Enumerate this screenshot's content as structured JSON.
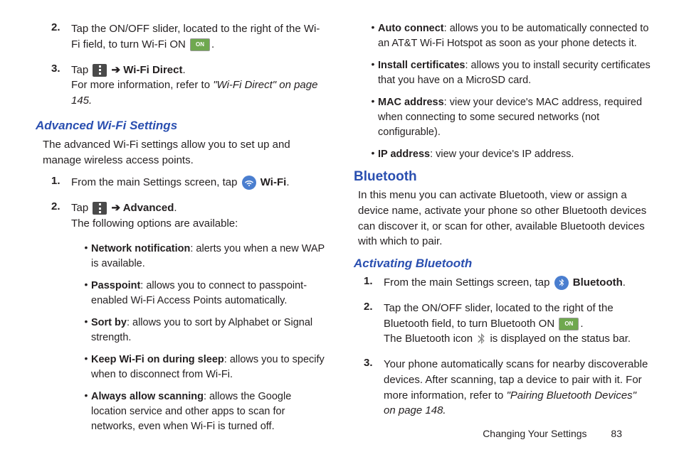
{
  "left": {
    "step2": {
      "num": "2.",
      "text_a": "Tap the ON/OFF slider, located to the right of the Wi-Fi field, to turn Wi-Fi ON ",
      "text_b": "."
    },
    "step3": {
      "num": "3.",
      "tap": "Tap ",
      "arrow": " ➔ ",
      "wifi_direct": "Wi-Fi Direct",
      "period": ".",
      "more_a": "For more information, refer to ",
      "more_b": "\"Wi-Fi Direct\"  on page 145."
    },
    "adv_hdr": "Advanced Wi-Fi Settings",
    "adv_intro": "The advanced Wi-Fi settings allow you to set up and manage wireless access points.",
    "adv_step1": {
      "num": "1.",
      "text_a": "From the main Settings screen, tap ",
      "wifi": " Wi-Fi",
      "period": "."
    },
    "adv_step2": {
      "num": "2.",
      "tap": "Tap ",
      "arrow": " ➔ ",
      "advanced": "Advanced",
      "period": ".",
      "follow": "The following options are available:"
    },
    "bullets": [
      {
        "term": "Network notification",
        "rest": ": alerts you when a new WAP is available."
      },
      {
        "term": "Passpoint",
        "rest": ": allows you to connect to passpoint-enabled Wi-Fi Access Points automatically."
      },
      {
        "term": "Sort by",
        "rest": ": allows you to sort by Alphabet or Signal strength."
      },
      {
        "term": "Keep Wi-Fi on during sleep",
        "rest": ": allows you to specify when to disconnect from Wi-Fi."
      },
      {
        "term": "Always allow scanning",
        "rest": ": allows the Google location service and other apps to scan for networks, even when Wi-Fi is turned off."
      }
    ]
  },
  "right": {
    "bullets_top": [
      {
        "term": "Auto connect",
        "rest": ": allows you to be automatically connected to an AT&T Wi-Fi Hotspot as soon as your phone detects it."
      },
      {
        "term": "Install certificates",
        "rest": ": allows you to install security certificates that you have on a MicroSD card."
      },
      {
        "term": "MAC address",
        "rest": ": view your device's MAC address, required when connecting to some secured networks (not configurable)."
      },
      {
        "term": "IP address",
        "rest": ": view your device's IP address."
      }
    ],
    "bt_hdr": "Bluetooth",
    "bt_intro": "In this menu you can activate Bluetooth, view or assign a device name, activate your phone so other Bluetooth devices can discover it, or scan for other, available Bluetooth devices with which to pair.",
    "act_hdr": "Activating Bluetooth",
    "bt_step1": {
      "num": "1.",
      "text_a": "From the main Settings screen, tap ",
      "bt": " Bluetooth",
      "period": "."
    },
    "bt_step2": {
      "num": "2.",
      "text_a": "Tap the ON/OFF slider, located to the right of the Bluetooth field, to turn Bluetooth ON ",
      "period": ".",
      "line2a": "The Bluetooth icon ",
      "line2b": " is displayed on the status bar."
    },
    "bt_step3": {
      "num": "3.",
      "text_a": "Your phone automatically scans for nearby discoverable devices. After scanning, tap a device to pair with it. For more information, refer to ",
      "ital": "\"Pairing Bluetooth Devices\"  on page 148."
    }
  },
  "footer": {
    "section": "Changing Your Settings",
    "page": "83"
  },
  "icons": {
    "on_label": "ON"
  }
}
